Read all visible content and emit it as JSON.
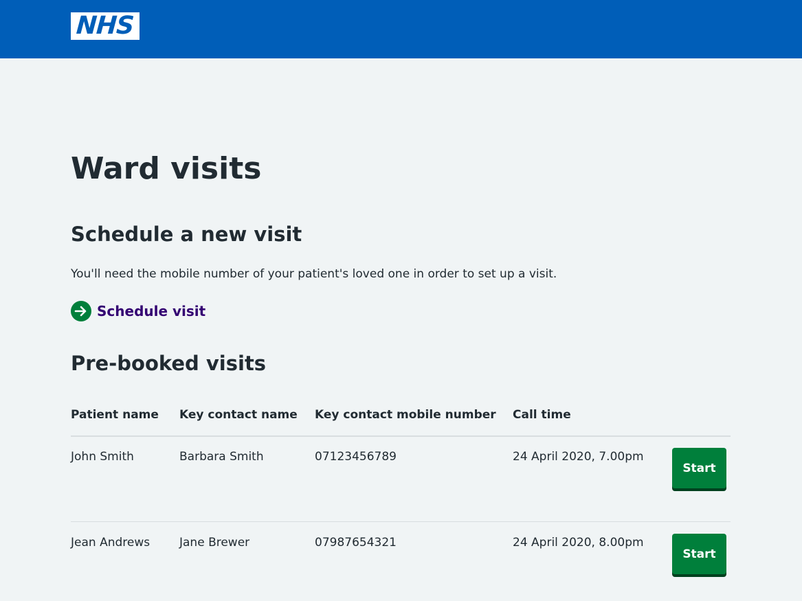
{
  "header": {
    "logo_text": "NHS",
    "background_color": "#005eb8"
  },
  "page": {
    "title": "Ward visits"
  },
  "schedule": {
    "heading": "Schedule a new visit",
    "description": "You'll need the mobile number of your patient's loved one in order to set up a visit.",
    "action_label": "Schedule visit",
    "action_icon": "arrow-right-circle-icon"
  },
  "prebooked": {
    "heading": "Pre-booked visits",
    "columns": [
      "Patient name",
      "Key contact name",
      "Key contact mobile number",
      "Call time"
    ],
    "rows": [
      {
        "patient_name": "John Smith",
        "contact_name": "Barbara Smith",
        "contact_mobile": "07123456789",
        "call_time": "24 April 2020, 7.00pm",
        "action_label": "Start"
      },
      {
        "patient_name": "Jean Andrews",
        "contact_name": "Jane Brewer",
        "contact_mobile": "07987654321",
        "call_time": "24 April 2020, 8.00pm",
        "action_label": "Start"
      }
    ]
  },
  "colors": {
    "page_background": "#f0f4f5",
    "text": "#212b32",
    "link": "#330072",
    "button": "#007f3b",
    "button_shadow": "#00401e",
    "border": "#d8dde0"
  }
}
